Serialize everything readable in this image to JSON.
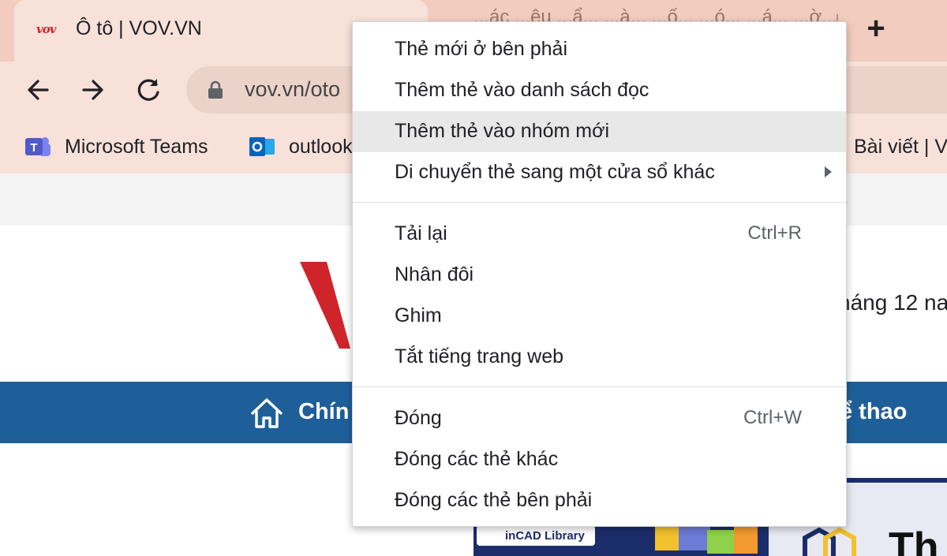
{
  "browser": {
    "active_tab": {
      "favicon_text": "vov",
      "title": "Ô tô | VOV.VN"
    },
    "inactive_tab": {
      "title": "...ác ...ệu ...ẩ... ...à... ...ố... ...ó... ...á... ...ờ..."
    },
    "new_tab_symbol": "+",
    "address_bar": {
      "url": "vov.vn/oto"
    },
    "bookmarks": [
      {
        "label": "Microsoft Teams",
        "icon": "teams-icon"
      },
      {
        "label": "outlook",
        "icon": "outlook-icon"
      }
    ],
    "bookmarks_right_text": "Bài viết | V"
  },
  "page": {
    "date_fragment": "háng 12 na",
    "nav_home_label": "Chín",
    "nav_sports_label": "ể thao",
    "ad_left_text": "inCAD Library",
    "ad_right_text": "Th"
  },
  "context_menu": {
    "groups": [
      [
        {
          "label": "Thẻ mới ở bên phải"
        },
        {
          "label": "Thêm thẻ vào danh sách đọc"
        },
        {
          "label": "Thêm thẻ vào nhóm mới",
          "highlighted": true
        },
        {
          "label": "Di chuyển thẻ sang một cửa sổ khác",
          "submenu": true
        }
      ],
      [
        {
          "label": "Tải lại",
          "shortcut": "Ctrl+R"
        },
        {
          "label": "Nhân đôi"
        },
        {
          "label": "Ghim"
        },
        {
          "label": "Tắt tiếng trang web"
        }
      ],
      [
        {
          "label": "Đóng",
          "shortcut": "Ctrl+W"
        },
        {
          "label": "Đóng các thẻ khác"
        },
        {
          "label": "Đóng các thẻ bên phải"
        }
      ]
    ]
  },
  "colors": {
    "tabstrip": "#f2cdbf",
    "toolbar": "#f7e1d9",
    "nav_blue": "#1f5f99",
    "vov_red": "#d0242b",
    "menu_highlight": "#e8e8e8"
  }
}
